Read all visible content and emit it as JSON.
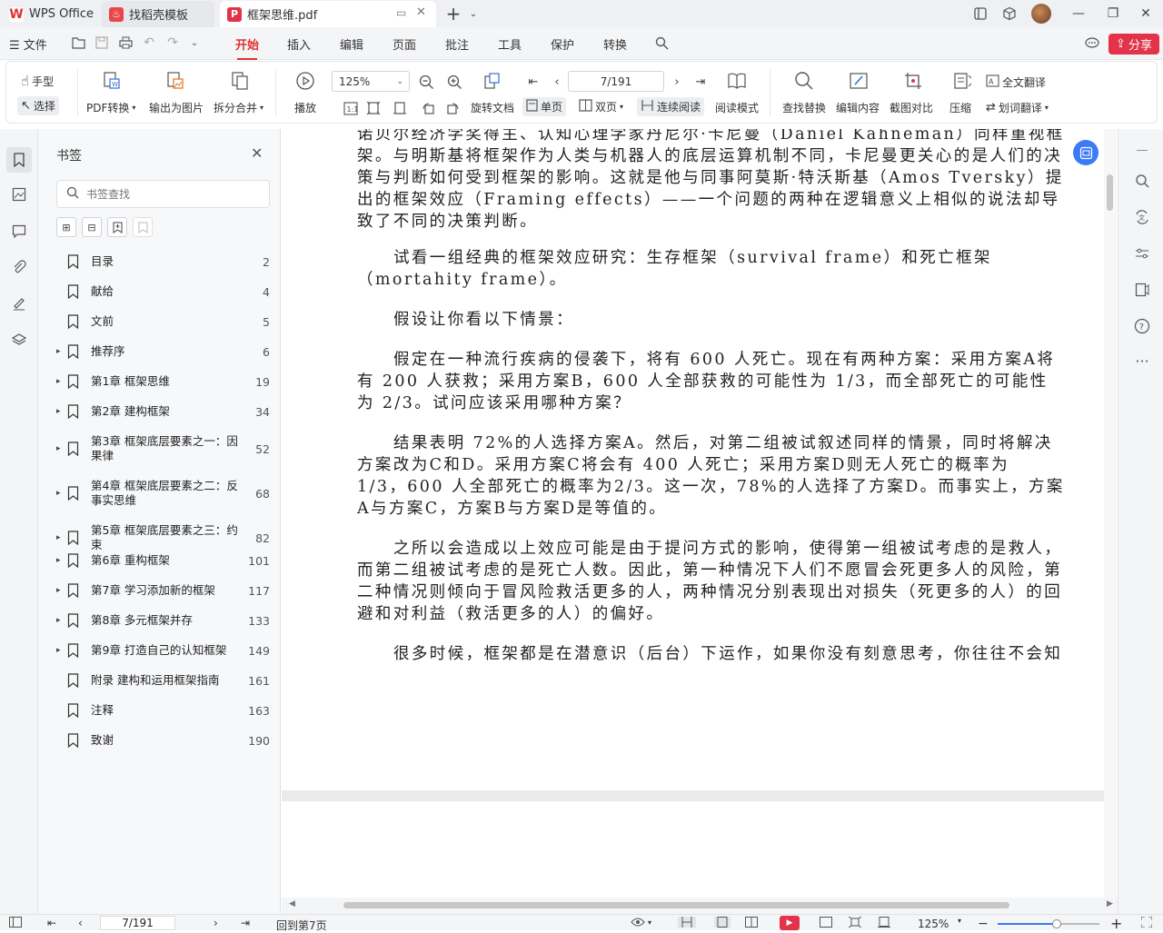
{
  "titlebar": {
    "tabs": [
      {
        "label": "WPS Office",
        "icon": "wps-logo-icon"
      },
      {
        "label": "找稻壳模板",
        "icon": "docer-logo-icon"
      },
      {
        "label": "框架思维.pdf",
        "icon": "pdf-logo-icon"
      }
    ]
  },
  "menubar": {
    "file": "文件",
    "items": [
      "开始",
      "插入",
      "编辑",
      "页面",
      "批注",
      "工具",
      "保护",
      "转换"
    ],
    "active": "开始",
    "share": "分享"
  },
  "toolbar": {
    "hand": "手型",
    "select": "选择",
    "pdf_convert": "PDF转换",
    "export_image": "输出为图片",
    "split_merge": "拆分合并",
    "play": "播放",
    "zoom": "125%",
    "page": "7/191",
    "rotate": "旋转文档",
    "single": "单页",
    "double": "双页",
    "continuous": "连续阅读",
    "read_mode": "阅读模式",
    "find_replace": "查找替换",
    "edit_content": "编辑内容",
    "screenshot_compare": "截图对比",
    "compress": "压缩",
    "full_translate": "全文翻译",
    "word_translate": "划词翻译"
  },
  "bookmarks": {
    "title": "书签",
    "search_placeholder": "书签查找",
    "items": [
      {
        "label": "目录",
        "page": "2",
        "expandable": false
      },
      {
        "label": "献给",
        "page": "4",
        "expandable": false
      },
      {
        "label": "文前",
        "page": "5",
        "expandable": false
      },
      {
        "label": "推荐序",
        "page": "6",
        "expandable": true
      },
      {
        "label": "第1章 框架思维",
        "page": "19",
        "expandable": true
      },
      {
        "label": "第2章 建构框架",
        "page": "34",
        "expandable": true
      },
      {
        "label": "第3章 框架底层要素之一：因果律",
        "page": "52",
        "expandable": true
      },
      {
        "label": "第4章 框架底层要素之二：反事实思维",
        "page": "68",
        "expandable": true
      },
      {
        "label": "第5章 框架底层要素之三：约束",
        "page": "82",
        "expandable": true
      },
      {
        "label": "第6章 重构框架",
        "page": "101",
        "expandable": true
      },
      {
        "label": "第7章 学习添加新的框架",
        "page": "117",
        "expandable": true
      },
      {
        "label": "第8章 多元框架并存",
        "page": "133",
        "expandable": true
      },
      {
        "label": "第9章 打造自己的认知框架",
        "page": "149",
        "expandable": true
      },
      {
        "label": "附录 建构和运用框架指南",
        "page": "161",
        "expandable": false
      },
      {
        "label": "注释",
        "page": "163",
        "expandable": false
      },
      {
        "label": "致谢",
        "page": "190",
        "expandable": false
      }
    ]
  },
  "document": {
    "paragraphs": [
      "诺贝尔经济学奖得主、认知心理学家丹尼尔·卡尼曼（Daniel Kahneman）同样重视框架。与明斯基将框架作为人类与机器人的底层运算机制不同，卡尼曼更关心的是人们的决策与判断如何受到框架的影响。这就是他与同事阿莫斯·特沃斯基（Amos Tversky）提出的框架效应（Framing effects）——一个问题的两种在逻辑意义上相似的说法却导致了不同的决策判断。",
      "试看一组经典的框架效应研究：生存框架（survival frame）和死亡框架（mortahity frame）。",
      "假设让你看以下情景：",
      "假定在一种流行疾病的侵袭下，将有 600 人死亡。现在有两种方案：采用方案A将有 200 人获救；采用方案B，600 人全部获救的可能性为 1/3，而全部死亡的可能性为 2/3。试问应该采用哪种方案？",
      "结果表明 72%的人选择方案A。然后，对第二组被试叙述同样的情景，同时将解决方案改为C和D。采用方案C将会有 400 人死亡；采用方案D则无人死亡的概率为 1/3，600 人全部死亡的概率为2/3。这一次，78%的人选择了方案D。而事实上，方案A与方案C，方案B与方案D是等值的。",
      "之所以会造成以上效应可能是由于提问方式的影响，使得第一组被试考虑的是救人，而第二组被试考虑的是死亡人数。因此，第一种情况下人们不愿冒会死更多人的风险，第二种情况则倾向于冒风险救活更多的人，两种情况分别表现出对损失（死更多的人）的回避和对利益（救活更多的人）的偏好。",
      "很多时候，框架都是在潜意识（后台）下运作，如果你没有刻意思考，你往往不会知"
    ]
  },
  "statusbar": {
    "page": "7/191",
    "back_to": "回到第7页",
    "zoom": "125%",
    "zoom_fraction": 0.58
  },
  "colors": {
    "accent": "#e03131",
    "share_bg": "#e2334a",
    "float_btn": "#3d7bf5"
  }
}
